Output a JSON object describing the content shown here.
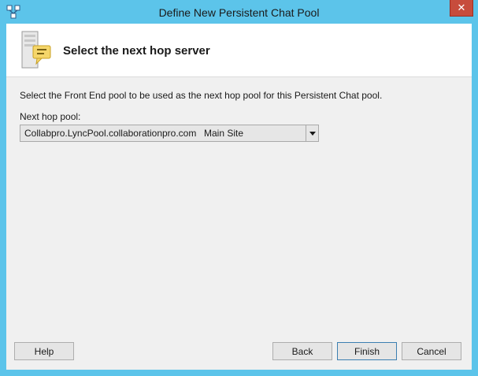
{
  "window": {
    "title": "Define New Persistent Chat Pool",
    "close_glyph": "✕"
  },
  "header": {
    "title": "Select the next hop server",
    "icon": "server-chat-icon"
  },
  "main": {
    "instruction": "Select the Front End pool to be used as the next hop pool for this Persistent Chat pool.",
    "next_hop_label": "Next hop pool:",
    "next_hop_value": "Collabpro.LyncPool.collaborationpro.com",
    "next_hop_site": "Main Site"
  },
  "buttons": {
    "help": "Help",
    "back": "Back",
    "finish": "Finish",
    "cancel": "Cancel"
  },
  "colors": {
    "frame": "#5cc4ea",
    "close": "#c74c3c",
    "client": "#f0f0f0"
  }
}
